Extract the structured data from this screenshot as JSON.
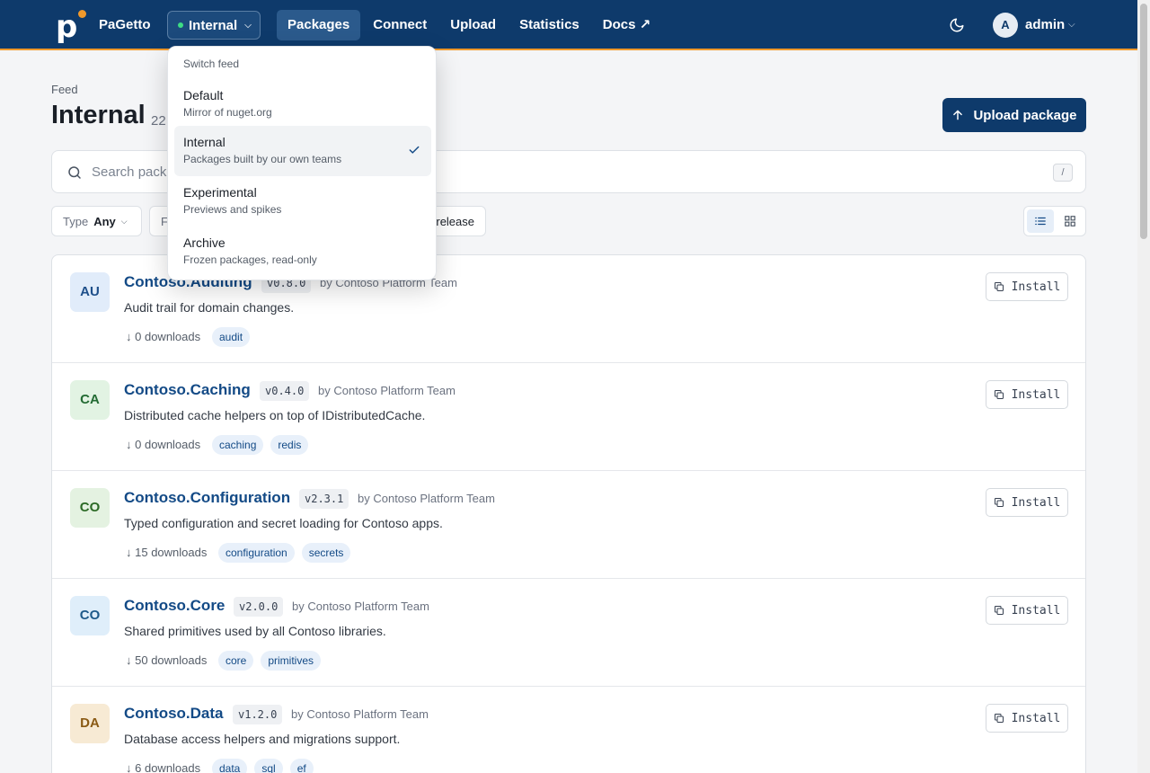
{
  "app": {
    "brand": "PaGetto"
  },
  "header": {
    "feed_selector": "Internal",
    "nav": [
      "Packages",
      "Connect",
      "Upload",
      "Statistics",
      "Docs ↗"
    ],
    "active_nav": "Packages",
    "user": {
      "initial": "A",
      "name": "admin"
    }
  },
  "page": {
    "label": "Feed",
    "title": "Internal",
    "count": "22",
    "upload_label": "Upload package"
  },
  "search": {
    "placeholder": "Search pack",
    "shortcut": "/"
  },
  "filters": {
    "type_label": "Type",
    "type_value": "Any",
    "second_partial": "F",
    "third_partial": "release"
  },
  "dropdown": {
    "heading": "Switch feed",
    "items": [
      {
        "name": "Default",
        "desc": "Mirror of nuget.org",
        "selected": false
      },
      {
        "name": "Internal",
        "desc": "Packages built by our own teams",
        "selected": true
      },
      {
        "name": "Experimental",
        "desc": "Previews and spikes",
        "selected": false
      },
      {
        "name": "Archive",
        "desc": "Frozen packages, read-only",
        "selected": false
      }
    ]
  },
  "packages": [
    {
      "initials": "AU",
      "name": "Contoso.Auditing",
      "version": "v0.8.0",
      "author": "by Contoso Platform Team",
      "desc": "Audit trail for domain changes.",
      "downloads": "0 downloads",
      "tags": [
        "audit"
      ],
      "badge_bg": "#e1ecfa",
      "badge_fg": "#1e4f8a"
    },
    {
      "initials": "CA",
      "name": "Contoso.Caching",
      "version": "v0.4.0",
      "author": "by Contoso Platform Team",
      "desc": "Distributed cache helpers on top of IDistributedCache.",
      "downloads": "0 downloads",
      "tags": [
        "caching",
        "redis"
      ],
      "badge_bg": "#e2f3e3",
      "badge_fg": "#236b33"
    },
    {
      "initials": "CO",
      "name": "Contoso.Configuration",
      "version": "v2.3.1",
      "author": "by Contoso Platform Team",
      "desc": "Typed configuration and secret loading for Contoso apps.",
      "downloads": "15 downloads",
      "tags": [
        "configuration",
        "secrets"
      ],
      "badge_bg": "#e4f2e1",
      "badge_fg": "#2c6a26"
    },
    {
      "initials": "CO",
      "name": "Contoso.Core",
      "version": "v2.0.0",
      "author": "by Contoso Platform Team",
      "desc": "Shared primitives used by all Contoso libraries.",
      "downloads": "50 downloads",
      "tags": [
        "core",
        "primitives"
      ],
      "badge_bg": "#dfeefa",
      "badge_fg": "#1e5a8a"
    },
    {
      "initials": "DA",
      "name": "Contoso.Data",
      "version": "v1.2.0",
      "author": "by Contoso Platform Team",
      "desc": "Database access helpers and migrations support.",
      "downloads": "6 downloads",
      "tags": [
        "data",
        "sql",
        "ef"
      ],
      "badge_bg": "#f7ead4",
      "badge_fg": "#8a5a14"
    }
  ],
  "install_label": "Install",
  "colors": {
    "nav_bg": "#0e3a6b",
    "accent": "#f0992b",
    "link": "#134a86"
  }
}
